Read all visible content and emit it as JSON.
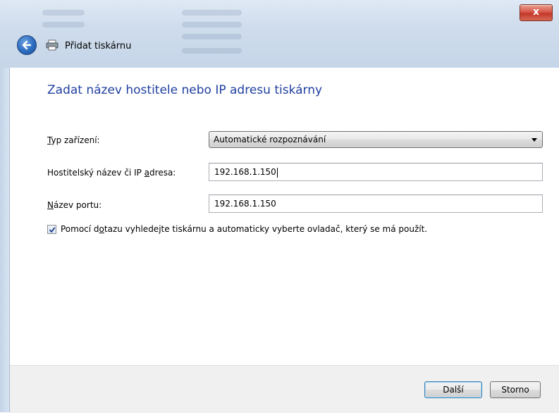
{
  "window": {
    "title": "Přidat tiskárnu",
    "close_label": "x"
  },
  "page": {
    "heading": "Zadat název hostitele nebo IP adresu tiskárny"
  },
  "form": {
    "device_type": {
      "label_pre": "",
      "label_accel": "T",
      "label_post": "yp zařízení:",
      "value": "Automatické rozpoznávání"
    },
    "hostname": {
      "label_pre": "Hostitelský název či IP ",
      "label_accel": "a",
      "label_post": "dresa:",
      "value": "192.168.1.150"
    },
    "port_name": {
      "label_pre": "",
      "label_accel": "N",
      "label_post": "ázev portu:",
      "value": "192.168.1.150"
    },
    "query_checkbox": {
      "checked": true,
      "label_pre": "Pomocí d",
      "label_accel": "o",
      "label_post": "tazu vyhledejte tiskárnu a automaticky vyberte ovladač, který se má použít."
    }
  },
  "footer": {
    "next_label": "Další",
    "cancel_label": "Storno"
  },
  "colors": {
    "heading": "#1f3f9f",
    "close_button": "#c2382b",
    "footer_bg": "#f0f0f0"
  }
}
